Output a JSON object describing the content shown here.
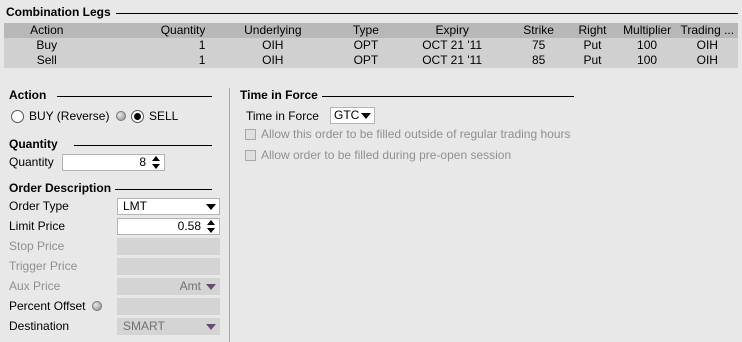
{
  "combination_legs": {
    "title": "Combination Legs",
    "columns": [
      "Action",
      "Quantity",
      "Underlying",
      "Type",
      "Expiry",
      "Strike",
      "Right",
      "Multiplier",
      "Trading ..."
    ],
    "rows": [
      [
        "Buy",
        "1",
        "OIH",
        "OPT",
        "OCT 21 '11",
        "75",
        "Put",
        "100",
        "OIH"
      ],
      [
        "Sell",
        "1",
        "OIH",
        "OPT",
        "OCT 21 '11",
        "85",
        "Put",
        "100",
        "OIH"
      ]
    ]
  },
  "action": {
    "title": "Action",
    "buy_label": "BUY (Reverse)",
    "sell_label": "SELL",
    "selected": "SELL"
  },
  "quantity": {
    "title": "Quantity",
    "label": "Quantity",
    "value": "8"
  },
  "order_description": {
    "title": "Order Description",
    "order_type_label": "Order Type",
    "order_type_value": "LMT",
    "limit_price_label": "Limit Price",
    "limit_price_value": "0.58",
    "stop_price_label": "Stop Price",
    "trigger_price_label": "Trigger Price",
    "aux_price_label": "Aux Price",
    "aux_price_unit": "Amt",
    "percent_offset_label": "Percent Offset",
    "destination_label": "Destination",
    "destination_value": "SMART"
  },
  "time_in_force": {
    "title": "Time in Force",
    "label": "Time in Force",
    "value": "GTC",
    "outside_rth_label": "Allow this order to be filled outside of regular trading hours",
    "pre_open_label": "Allow order to be filled during pre-open session"
  }
}
